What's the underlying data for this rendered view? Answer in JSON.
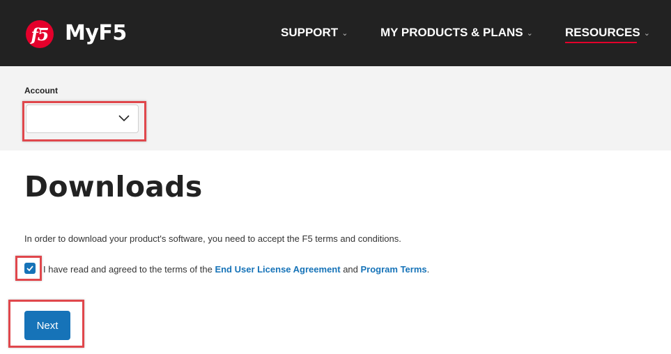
{
  "header": {
    "logo_text": "f5",
    "brand": "MyF5",
    "nav": [
      {
        "label": "SUPPORT"
      },
      {
        "label": "MY PRODUCTS & PLANS"
      },
      {
        "label": "RESOURCES",
        "active": true
      }
    ]
  },
  "account": {
    "label": "Account",
    "selected_value": ""
  },
  "main": {
    "title": "Downloads",
    "intro": "In order to download your product's software, you need to accept the F5 terms and conditions.",
    "agreement": {
      "checked": true,
      "prefix": "I have read and agreed to the terms of the ",
      "eula_link": "End User License Agreement",
      "middle": " and ",
      "program_terms_link": "Program Terms",
      "suffix": "."
    },
    "next_label": "Next"
  },
  "colors": {
    "header_bg": "#222222",
    "brand_red": "#e4002b",
    "link_blue": "#1673b8",
    "highlight_red": "#e0474c",
    "account_band": "#f3f3f3"
  }
}
